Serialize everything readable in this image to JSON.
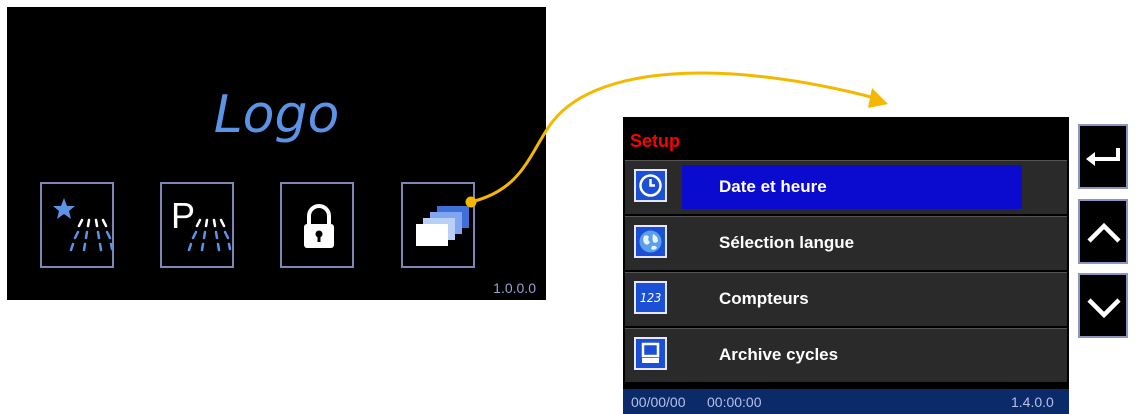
{
  "home": {
    "logo_text": "Logo",
    "buttons": [
      {
        "icon": "star-spray-icon"
      },
      {
        "icon": "p-spray-icon"
      },
      {
        "icon": "lock-icon"
      },
      {
        "icon": "stacked-cards-icon"
      }
    ],
    "version": "1.0.0.0"
  },
  "setup": {
    "title": "Setup",
    "items": [
      {
        "label": "Date et heure",
        "icon": "clock-icon",
        "selected": true
      },
      {
        "label": "Sélection langue",
        "icon": "globe-icon",
        "selected": false
      },
      {
        "label": "Compteurs",
        "icon": "counter-icon",
        "counter_text": "123",
        "selected": false
      },
      {
        "label": "Archive cycles",
        "icon": "computer-icon",
        "selected": false
      }
    ],
    "status": {
      "date": "00/00/00",
      "time": "00:00:00",
      "version": "1.4.0.0"
    }
  },
  "nav": {
    "buttons": [
      {
        "icon": "back-arrow-icon"
      },
      {
        "icon": "chevron-up-icon"
      },
      {
        "icon": "chevron-down-icon"
      }
    ]
  },
  "colors": {
    "logo": "#5b93e6",
    "setup_title": "#ff0000",
    "highlight": "#0b0bd0",
    "connector": "#f5b800",
    "icon_bg": "#1a4fd6"
  }
}
